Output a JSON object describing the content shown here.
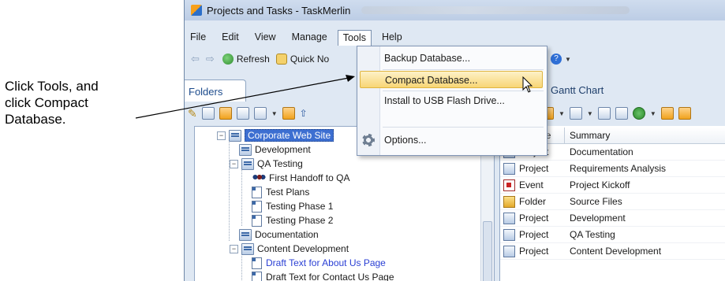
{
  "callout": {
    "line1": "Click Tools, and",
    "line2": "click Compact",
    "line3": "Database."
  },
  "window": {
    "title": "Projects and Tasks - TaskMerlin"
  },
  "menubar": {
    "items": [
      "File",
      "Edit",
      "View",
      "Manage",
      "Tools",
      "Help"
    ]
  },
  "toolbar": {
    "refresh_label": "Refresh",
    "quick_note_label": "Quick No",
    "partial_label": "y"
  },
  "tabs": {
    "folders": "Folders",
    "gantt": "Gantt Chart"
  },
  "tools_menu": {
    "items": [
      {
        "label": "Backup Database...",
        "icon": "none"
      },
      {
        "label": "Compact Database...",
        "icon": "none",
        "highlighted": true
      },
      {
        "label": "Install to USB Flash Drive...",
        "icon": "none"
      },
      {
        "label": "Options...",
        "icon": "gear-icon"
      }
    ]
  },
  "tree": {
    "nodes": [
      {
        "label": "Corporate Web Site",
        "icon": "project-icon",
        "selected": true
      },
      {
        "label": "Development",
        "icon": "project-icon"
      },
      {
        "label": "QA Testing",
        "icon": "project-icon"
      },
      {
        "label": "First Handoff to QA",
        "icon": "people-icon"
      },
      {
        "label": "Test Plans",
        "icon": "document-icon"
      },
      {
        "label": "Testing Phase 1",
        "icon": "task-icon"
      },
      {
        "label": "Testing Phase 2",
        "icon": "task-icon"
      },
      {
        "label": "Documentation",
        "icon": "project-icon"
      },
      {
        "label": "Content Development",
        "icon": "project-icon"
      },
      {
        "label": "Draft Text for About Us Page",
        "icon": "task-icon",
        "link": true
      },
      {
        "label": "Draft Text for Contact Us Page",
        "icon": "task-icon"
      }
    ]
  },
  "grid": {
    "headers": {
      "type": "Item Type",
      "summary": "Summary"
    },
    "rows": [
      {
        "type": "Project",
        "summary": "Documentation",
        "icon": "project-icon"
      },
      {
        "type": "Project",
        "summary": "Requirements Analysis",
        "icon": "project-icon"
      },
      {
        "type": "Event",
        "summary": "Project Kickoff",
        "icon": "event-icon"
      },
      {
        "type": "Folder",
        "summary": "Source Files",
        "icon": "folder-icon"
      },
      {
        "type": "Project",
        "summary": "Development",
        "icon": "project-icon"
      },
      {
        "type": "Project",
        "summary": "QA Testing",
        "icon": "project-icon"
      },
      {
        "type": "Project",
        "summary": "Content Development",
        "icon": "project-icon"
      }
    ]
  },
  "colors": {
    "highlight": "#f8d675",
    "selection": "#3d6fd1",
    "window_bg": "#dfe8f3"
  }
}
